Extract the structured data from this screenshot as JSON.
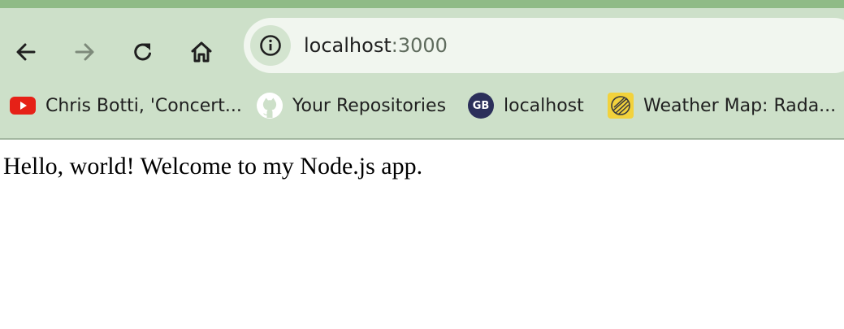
{
  "browser": {
    "address_host": "localhost",
    "address_port": ":3000",
    "nav_icons": [
      "back-arrow-icon",
      "forward-arrow-icon",
      "reload-icon",
      "home-icon",
      "site-info-icon"
    ]
  },
  "bookmarks": [
    {
      "label": "Chris Botti, 'Concert...",
      "icon": "youtube-icon"
    },
    {
      "label": "Your Repositories",
      "icon": "github-icon"
    },
    {
      "label": "localhost",
      "icon": "gb-avatar-icon",
      "icon_text": "GB"
    },
    {
      "label": "Weather Map: Rada...",
      "icon": "weather-map-icon"
    }
  ],
  "page": {
    "body_text": "Hello, world! Welcome to my Node.js app."
  },
  "colors": {
    "toolbar_bg": "#cde0c9",
    "top_strip": "#8fbb86",
    "omnibox_bg": "#f1f6ef",
    "youtube_red": "#e62117",
    "gb_navy": "#2b2f5a",
    "weather_yellow": "#f2d23c"
  }
}
